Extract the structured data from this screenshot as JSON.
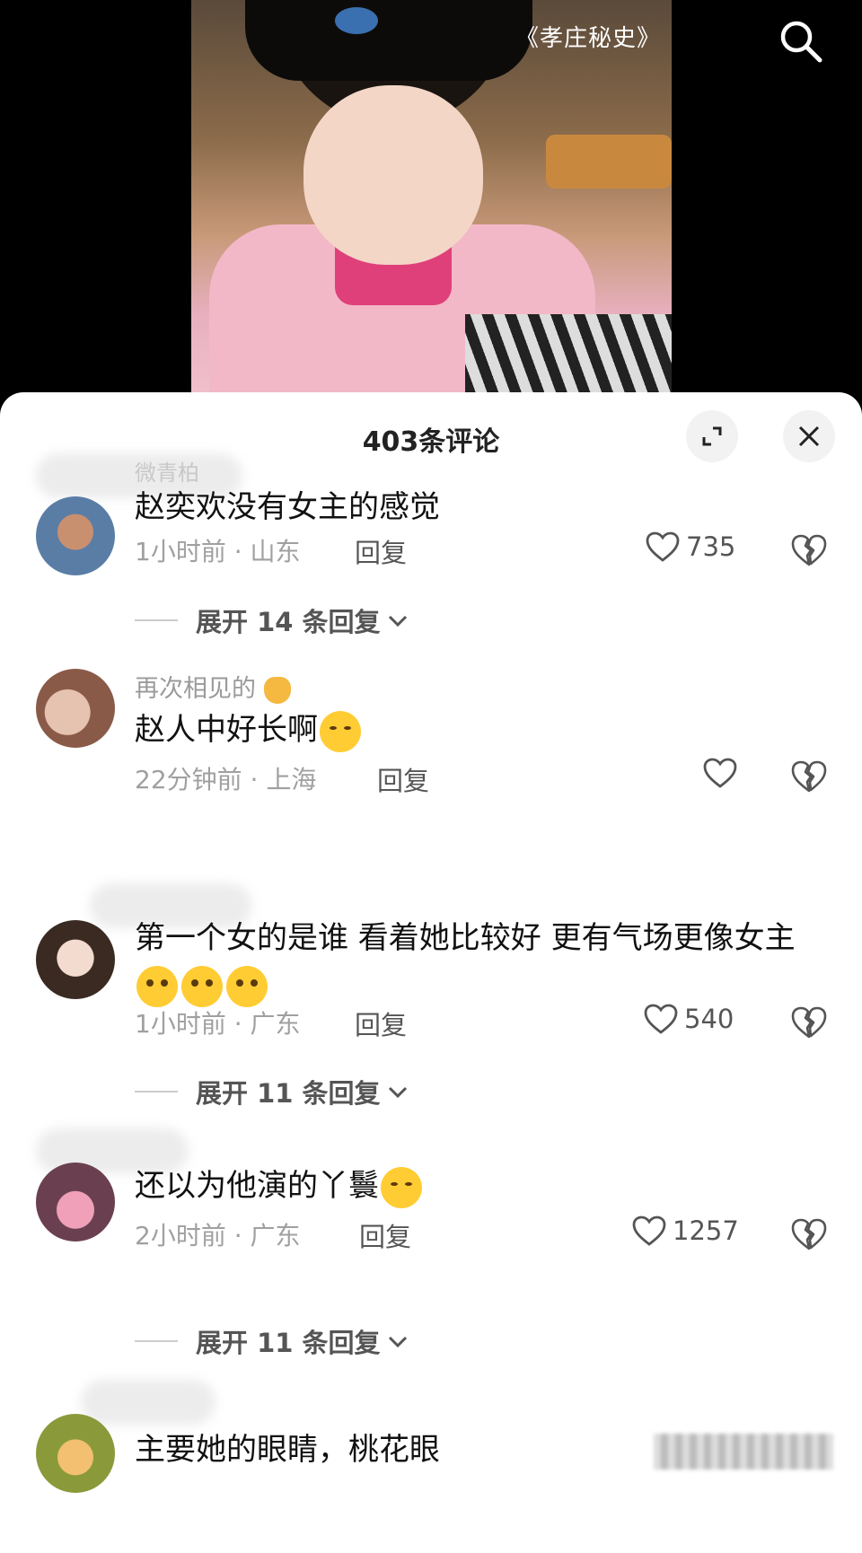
{
  "video": {
    "title": "《孝庄秘史》"
  },
  "comments_panel": {
    "title": "403条评论"
  },
  "comments": [
    {
      "username": "微青柏",
      "text": "赵奕欢没有女主的感觉",
      "time_location": "1小时前 · 山东",
      "reply_label": "回复",
      "likes": "735",
      "expand_label": "展开 14 条回复"
    },
    {
      "username": "再次相见的",
      "text": "赵人中好长啊",
      "time_location": "22分钟前 · 上海",
      "reply_label": "回复",
      "likes": "",
      "expand_label": ""
    },
    {
      "username": "",
      "text": "第一个女的是谁  看着她比较好 更有气场更像女主",
      "time_location": "1小时前 · 广东",
      "reply_label": "回复",
      "likes": "540",
      "expand_label": "展开 11 条回复"
    },
    {
      "username": "",
      "text": "还以为他演的丫鬟",
      "time_location": "2小时前 · 广东",
      "reply_label": "回复",
      "likes": "1257",
      "expand_label": "展开 11 条回复"
    },
    {
      "username": "",
      "text": "主要她的眼睛，桃花眼",
      "time_location": "",
      "reply_label": "",
      "likes": "",
      "expand_label": ""
    }
  ],
  "colors": {
    "sheet_bg": "#ffffff",
    "meta_text": "#a0a0a0",
    "primary_text": "#111111"
  }
}
